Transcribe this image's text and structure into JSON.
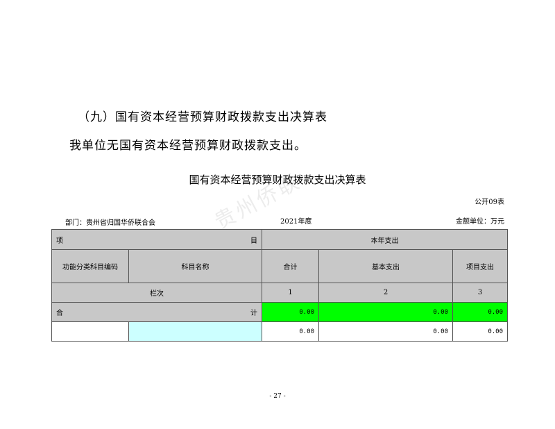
{
  "section_heading": "（九）国有资本经营预算财政拨款支出决算表",
  "body_text": "我单位无国有资本经营预算财政拨款支出。",
  "table": {
    "title": "国有资本经营预算财政拨款支出决算表",
    "form_code": "公开09表",
    "department": "部门：贵州省归国华侨联合会",
    "year": "2021年度",
    "unit": "金额单位：万元",
    "watermark": "贵州侨联",
    "header": {
      "item_left": "项",
      "item_right": "目",
      "current_year": "本年支出",
      "func_code": "功能分类科目编码",
      "subject_name": "科目名称",
      "total": "合计",
      "basic": "基本支出",
      "project": "项目支出"
    },
    "column_row": {
      "label": "栏次",
      "c1": "1",
      "c2": "2",
      "c3": "3"
    },
    "total_row": {
      "left": "合",
      "right": "计",
      "total": "0.00",
      "basic": "0.00",
      "project": "0.00"
    },
    "data_rows": [
      {
        "code": "",
        "name": "",
        "total": "0.00",
        "basic": "0.00",
        "project": "0.00"
      }
    ]
  },
  "page_number": "- 27 -"
}
